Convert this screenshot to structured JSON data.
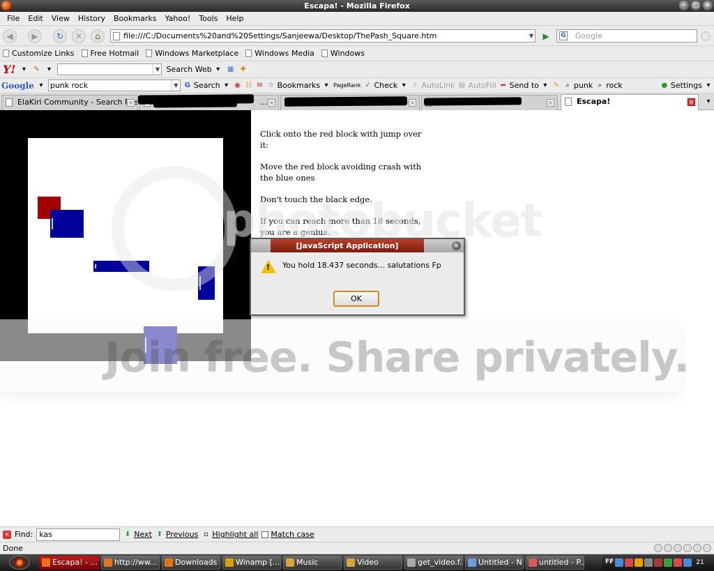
{
  "window": {
    "title": "Escapa! - Mozilla Firefox"
  },
  "menu": [
    "File",
    "Edit",
    "View",
    "History",
    "Bookmarks",
    "Yahoo!",
    "Tools",
    "Help"
  ],
  "nav": {
    "url": "file:///C:/Documents%20and%20Settings/Sanjeewa/Desktop/ThePash_Square.htm",
    "search_placeholder": "Google"
  },
  "bookmarks": [
    "Customize Links",
    "Free Hotmail",
    "Windows Marketplace",
    "Windows Media",
    "Windows"
  ],
  "yahoo_bar": {
    "logo": "Y!",
    "search_label": "Search Web"
  },
  "google_bar": {
    "logo": "Google",
    "query": "punk rock",
    "search_label": "Search",
    "bookmarks_label": "Bookmarks",
    "pagerank_label": "PageRank",
    "check_label": "Check",
    "autolink_label": "AutoLink",
    "autofill_label": "AutoFill",
    "sendto_label": "Send to",
    "term1": "punk",
    "term2": "rock",
    "settings_label": "Settings"
  },
  "tabs": [
    {
      "label": "ElaKiri Community - Search Res..."
    },
    {
      "label": "..."
    },
    {
      "label": ""
    },
    {
      "label": "Escapa!"
    }
  ],
  "page": {
    "instructions": [
      "Click onto the red block with jump over it:",
      "Move the red block avoiding crash with the blue ones",
      "Don't touch the black edge.",
      "If you can reach more than 18 seconds, you are a genius."
    ]
  },
  "watermark": {
    "logo": "photobucket",
    "banner": "Join free. Share privately."
  },
  "dialog": {
    "title": "[JavaScript Application]",
    "message": "You hold 18.437 seconds... salutations Fp",
    "ok_label": "OK"
  },
  "find_bar": {
    "label": "Find:",
    "value": "kas",
    "next": "Next",
    "previous": "Previous",
    "highlight_all": "Highlight all",
    "match_case": "Match case"
  },
  "status": {
    "text": "Done"
  },
  "taskbar": {
    "items": [
      "Escapa! - ...",
      "http://ww...",
      "Downloads",
      "Winamp [...",
      "Music",
      "Video",
      "get_video.f...",
      "Untitled - N...",
      "untitled - P..."
    ],
    "tray_label": "FF",
    "clock": "21"
  },
  "colors": {
    "red_block": "#a50000",
    "blue_block": "#00009a",
    "game_edge": "#000000"
  }
}
